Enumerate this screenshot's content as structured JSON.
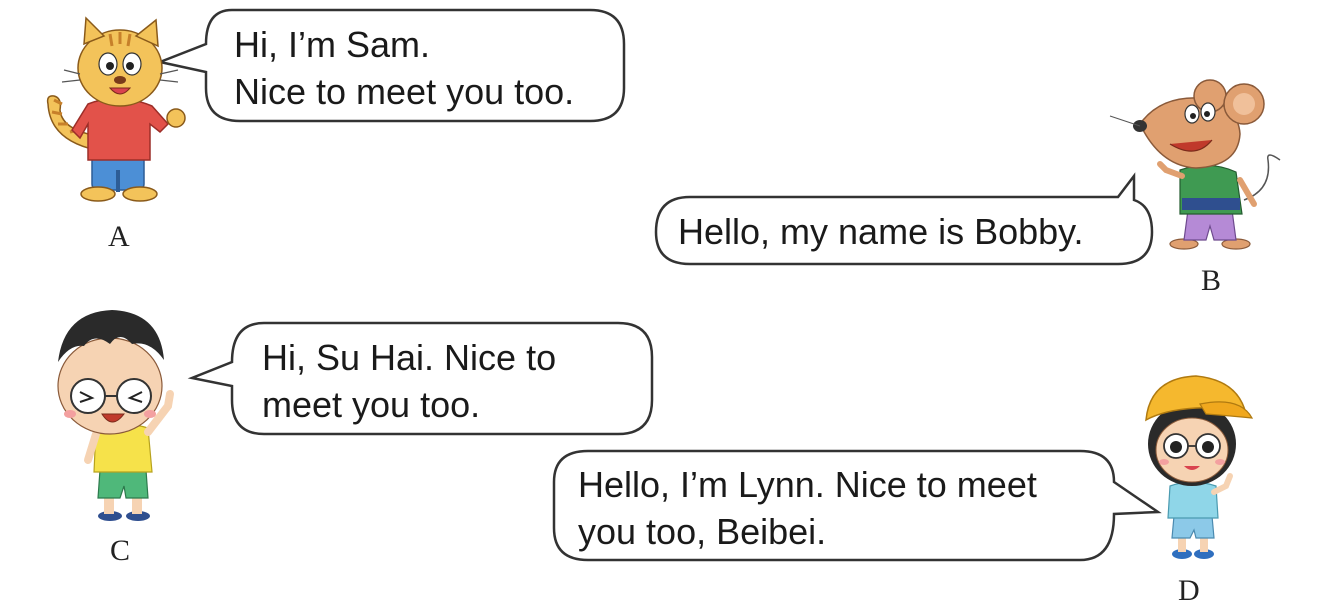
{
  "colors": {
    "bubble_stroke": "#333333",
    "bubble_fill": "#ffffff",
    "text": "#1a1a1a"
  },
  "panels": [
    {
      "id": "A",
      "label": "A",
      "character": "cat",
      "speech": [
        "Hi, I’m Sam.",
        "Nice to meet you too."
      ]
    },
    {
      "id": "B",
      "label": "B",
      "character": "mouse",
      "speech": [
        "Hello, my name is Bobby."
      ]
    },
    {
      "id": "C",
      "label": "C",
      "character": "boy-with-glasses",
      "speech": [
        "Hi, Su Hai. Nice to",
        "meet you too."
      ]
    },
    {
      "id": "D",
      "label": "D",
      "character": "girl-with-cap",
      "speech": [
        "Hello, I’m Lynn. Nice to meet",
        "you too, Beibei."
      ]
    }
  ]
}
